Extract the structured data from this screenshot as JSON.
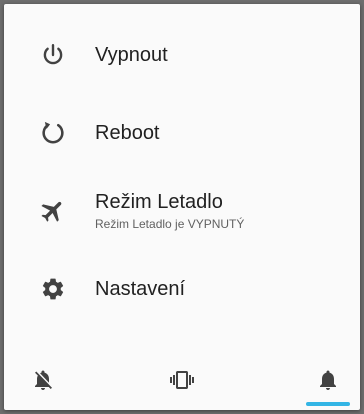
{
  "menu": {
    "items": [
      {
        "label": "Vypnout",
        "icon": "power-icon"
      },
      {
        "label": "Reboot",
        "icon": "restart-icon"
      },
      {
        "label": "Režim Letadlo",
        "sublabel": "Režim Letadlo je VYPNUTÝ",
        "icon": "airplane-icon"
      },
      {
        "label": "Nastavení",
        "icon": "settings-icon"
      }
    ]
  },
  "sound_modes": {
    "items": [
      {
        "name": "silent",
        "icon": "bell-off-icon"
      },
      {
        "name": "vibrate",
        "icon": "vibrate-icon"
      },
      {
        "name": "sound",
        "icon": "bell-icon",
        "selected": true
      }
    ],
    "accent_color": "#33b5e5"
  },
  "colors": {
    "icon": "#424242",
    "text": "#212121"
  }
}
